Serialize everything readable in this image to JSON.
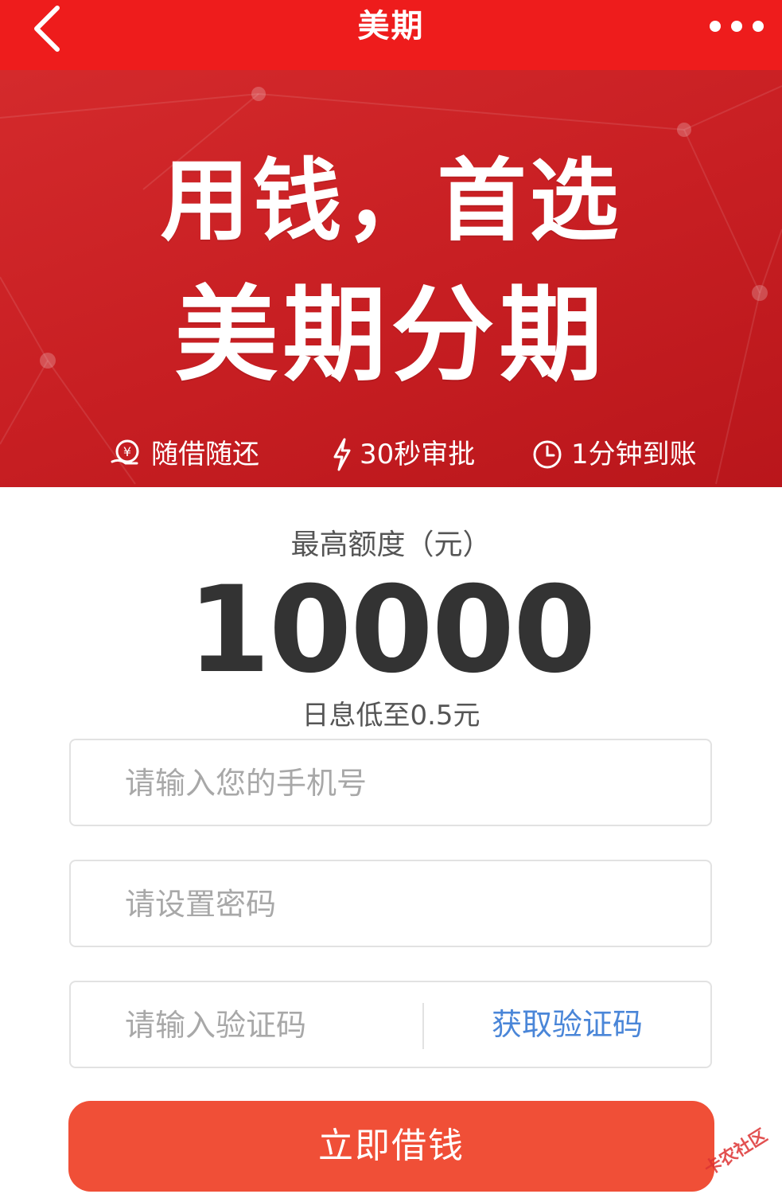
{
  "header": {
    "title": "美期",
    "back_icon": "chevron-left-icon",
    "more_icon": "more-dots-icon",
    "color": "#ee1c1c"
  },
  "banner": {
    "line1": "用钱，首选",
    "line2": "美期分期",
    "features": [
      {
        "icon": "yen-hand-icon",
        "label": "随借随还"
      },
      {
        "icon": "lightning-icon",
        "label": "30秒审批"
      },
      {
        "icon": "clock-icon",
        "label": "1分钟到账"
      }
    ]
  },
  "amount": {
    "label": "最高额度（元）",
    "value": "10000",
    "rate_text": "日息低至0.5元"
  },
  "form": {
    "phone_placeholder": "请输入您的手机号",
    "password_placeholder": "请设置密码",
    "code_placeholder": "请输入验证码",
    "get_code_label": "获取验证码",
    "submit_label": "立即借钱",
    "accent_color": "#f04f37",
    "link_color": "#4a86d8"
  },
  "watermark": "卡农社区"
}
